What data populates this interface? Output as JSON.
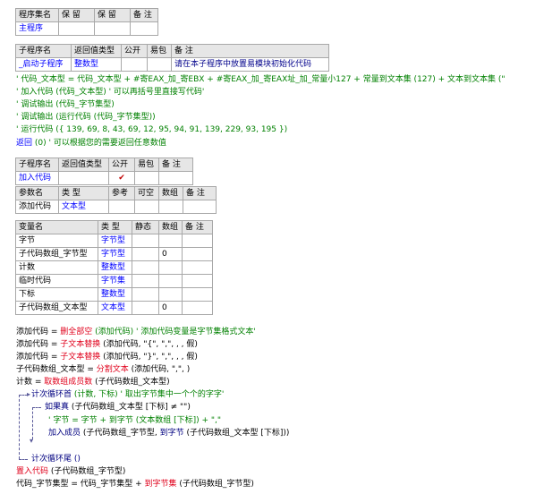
{
  "assembly_table": {
    "headers": [
      "程序集名",
      "保 留",
      "保 留",
      "备 注"
    ],
    "row": [
      "主程序",
      "",
      "",
      ""
    ]
  },
  "sub_table": {
    "headers": [
      "子程序名",
      "返回值类型",
      "公开",
      "易包",
      "备 注"
    ],
    "row": [
      "_启动子程序",
      "整数型",
      "",
      "",
      "请在本子程序中放置易模块初始化代码"
    ]
  },
  "code_block_1": [
    "' 代码_文本型 = 代码_文本型 + #寄EAX_加_寄EBX + #寄EAX_加_寄EAX址_加_常量小127 + 常量到文本集 (127) + 文本到文本集 (\"",
    "' 加入代码 (代码_文本型)  ' 可以再括号里直接写代码'",
    "' 调试输出 (代码_字节集型)",
    "' 调试输出 (运行代码 (代码_字节集型))",
    "' 运行代码 ({ 139, 69, 8, 43, 69, 12, 95, 94, 91, 139, 229, 93, 195 })"
  ],
  "return_line": {
    "keyword": "返回",
    "rest": " (0)  ' 可以根据您的需要返回任意数值"
  },
  "sub2_table": {
    "headers": [
      "子程序名",
      "返回值类型",
      "公开",
      "易包",
      "备 注"
    ],
    "row": [
      "加入代码",
      "",
      "✔",
      "",
      ""
    ]
  },
  "param_table": {
    "headers": [
      "参数名",
      "类 型",
      "参考",
      "可空",
      "数组",
      "备 注"
    ],
    "row": [
      "添加代码",
      "文本型",
      "",
      "",
      "",
      ""
    ]
  },
  "var_table": {
    "headers": [
      "变量名",
      "类 型",
      "静态",
      "数组",
      "备 注"
    ],
    "rows": [
      [
        "字节",
        "字节型",
        "",
        "",
        ""
      ],
      [
        "子代码数组_字节型",
        "字节型",
        "",
        "0",
        ""
      ],
      [
        "计数",
        "整数型",
        "",
        "",
        ""
      ],
      [
        "临时代码",
        "字节集",
        "",
        "",
        ""
      ],
      [
        "下标",
        "整数型",
        "",
        "",
        ""
      ],
      [
        "子代码数组_文本型",
        "文本型",
        "",
        "0",
        ""
      ]
    ]
  },
  "code_block_2": {
    "l1_a": "添加代码 = ",
    "l1_fn": "删全部空",
    "l1_b": " (添加代码)  ' 添加代码变量是字节集格式文本'",
    "l2_a": "添加代码 = ",
    "l2_fn": "子文本替换",
    "l2_b": " (添加代码, \"{\", \",\", , , 假)",
    "l3_a": "添加代码 = ",
    "l3_fn": "子文本替换",
    "l3_b": " (添加代码, \"}\", \",\", , , 假)",
    "l4_a": "子代码数组_文本型 = ",
    "l4_fn": "分割文本",
    "l4_b": " (添加代码, \",\", )",
    "l5_a": "计数 = ",
    "l5_fn": "取数组成员数",
    "l5_b": " (子代码数组_文本型)",
    "loop_kw": "计次循环首",
    "loop_rest": " (计数, 下标)  ' 取出字节集中一个个的字字'",
    "if_kw": "如果真",
    "if_rest": " (子代码数组_文本型 [下标] ≠ \"\")",
    "comment_line": "' 字节 = 字节 + 到字节 (文本数组 [下标]) + \",\"",
    "add_kw": "加入成员",
    "add_rest": " (子代码数组_字节型, ",
    "add_fn": "到字节",
    "add_rest2": " (子代码数组_文本型 [下标]))",
    "loop_end": "计次循环尾 ()",
    "ret_kw": "置入代码",
    "ret_rest": " (子代码数组_字节型)",
    "last_a": "代码_字节集型 = 代码_字节集型 + ",
    "last_fn": "到字节集",
    "last_b": " (子代码数组_字节型)"
  }
}
